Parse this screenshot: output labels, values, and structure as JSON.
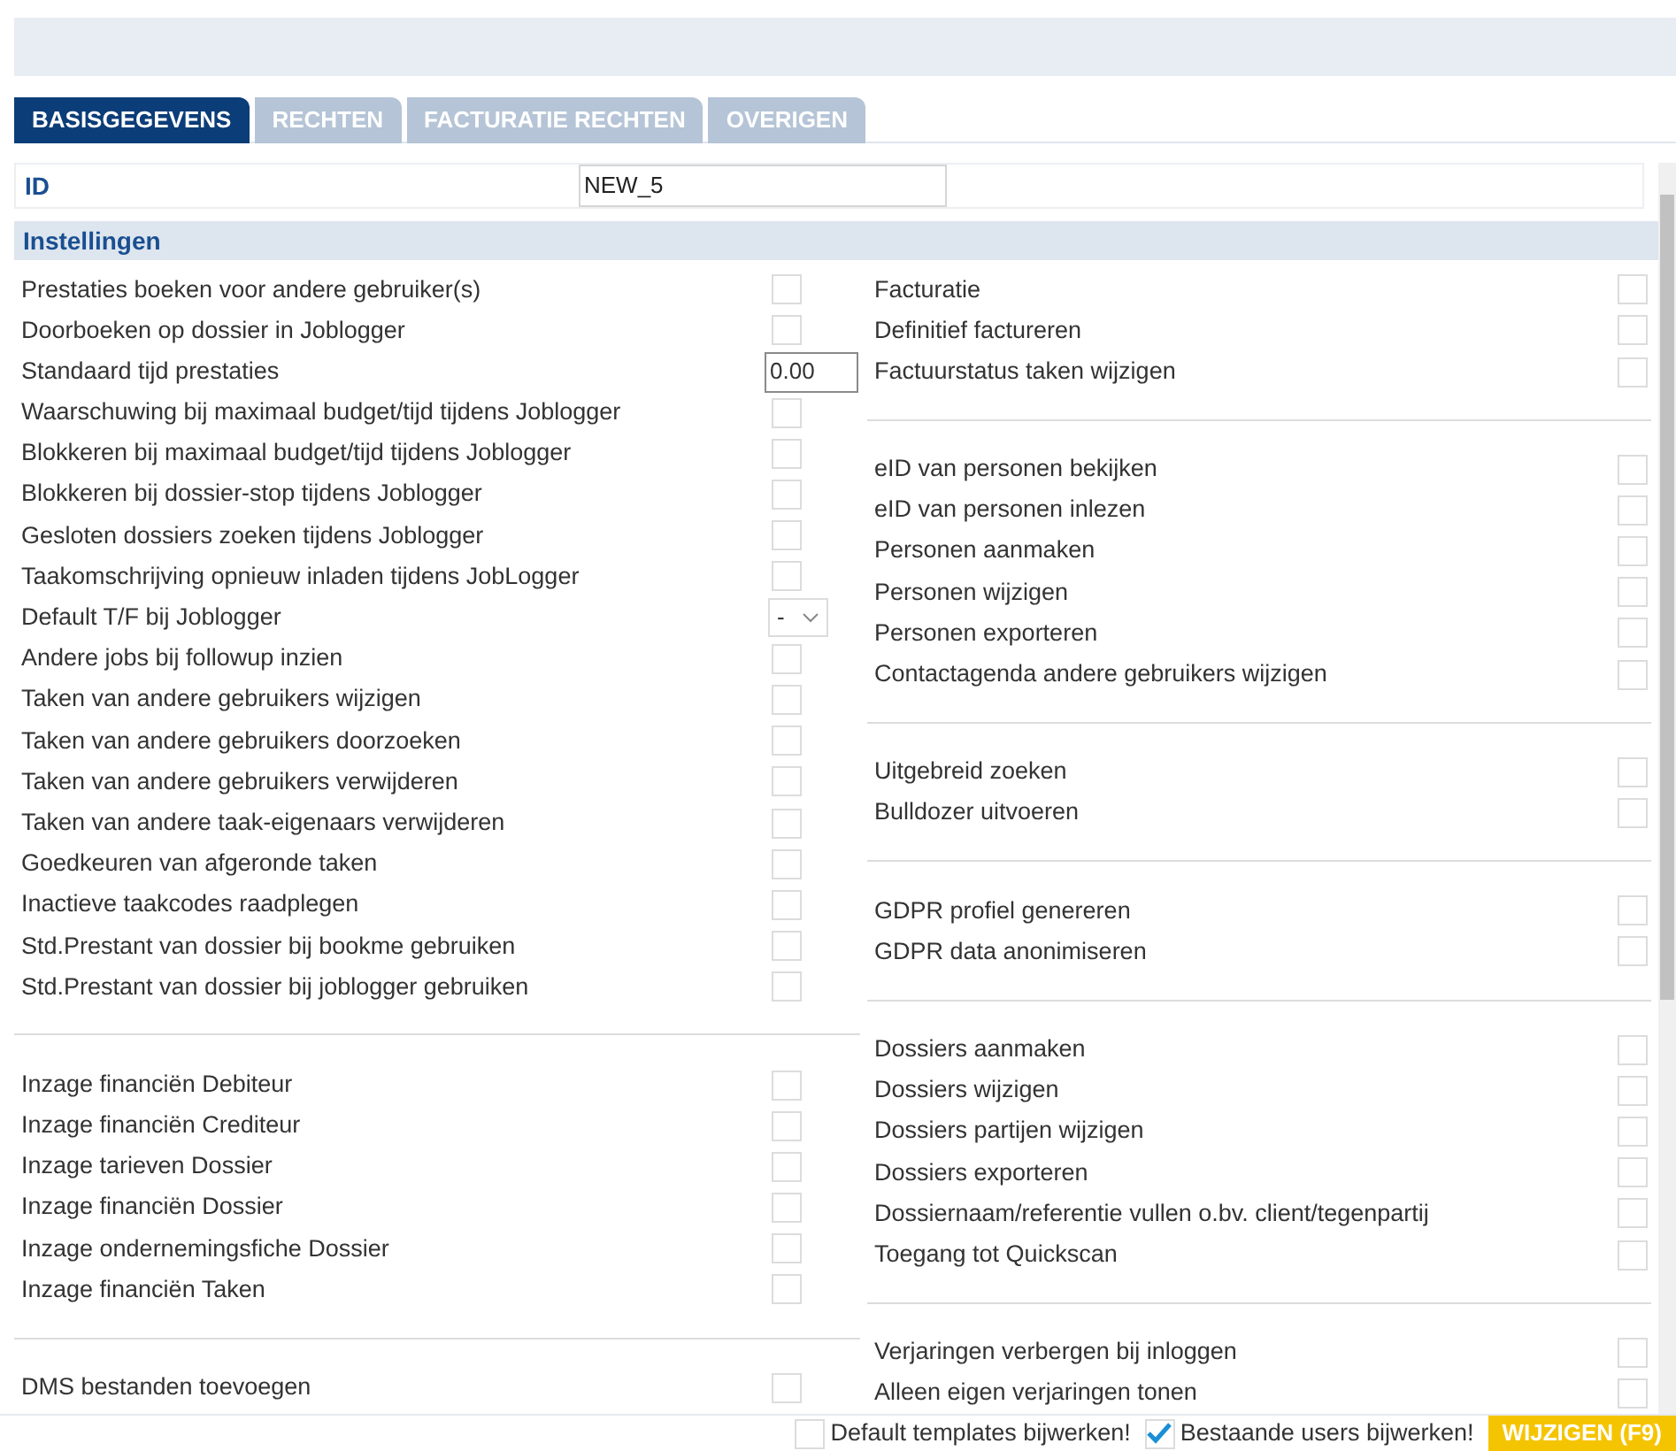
{
  "tabs": [
    {
      "label": "BASISGEGEVENS",
      "selected": true
    },
    {
      "label": "RECHTEN",
      "selected": false
    },
    {
      "label": "FACTURATIE RECHTEN",
      "selected": false
    },
    {
      "label": "OVERIGEN",
      "selected": false
    }
  ],
  "id_field": {
    "label": "ID",
    "value": "NEW_5"
  },
  "section": {
    "title": "Instellingen"
  },
  "left_groups": [
    {
      "items": [
        {
          "kind": "checkbox",
          "label": "Prestaties boeken voor andere gebruiker(s)",
          "checked": false
        },
        {
          "kind": "checkbox",
          "label": "Doorboeken op dossier in Joblogger",
          "checked": false
        },
        {
          "kind": "number",
          "label": "Standaard tijd prestaties",
          "value": "0.00"
        },
        {
          "kind": "checkbox",
          "label": "Waarschuwing bij maximaal budget/tijd tijdens Joblogger",
          "checked": false
        },
        {
          "kind": "checkbox",
          "label": "Blokkeren bij maximaal budget/tijd tijdens Joblogger",
          "checked": false
        },
        {
          "kind": "checkbox",
          "label": "Blokkeren bij dossier-stop tijdens Joblogger",
          "checked": false
        },
        {
          "kind": "checkbox",
          "label": "Gesloten dossiers zoeken tijdens Joblogger",
          "checked": false
        },
        {
          "kind": "checkbox",
          "label": "Taakomschrijving opnieuw inladen tijdens JobLogger",
          "checked": false
        },
        {
          "kind": "select",
          "label": "Default T/F bij Joblogger",
          "value": "-"
        },
        {
          "kind": "checkbox",
          "label": "Andere jobs bij followup inzien",
          "checked": false
        },
        {
          "kind": "checkbox",
          "label": "Taken van andere gebruikers wijzigen",
          "checked": false
        },
        {
          "kind": "checkbox",
          "label": "Taken van andere gebruikers doorzoeken",
          "checked": false
        },
        {
          "kind": "checkbox",
          "label": "Taken van andere gebruikers verwijderen",
          "checked": false
        },
        {
          "kind": "checkbox",
          "label": "Taken van andere taak-eigenaars verwijderen",
          "checked": false
        },
        {
          "kind": "checkbox",
          "label": "Goedkeuren van afgeronde taken",
          "checked": false
        },
        {
          "kind": "checkbox",
          "label": "Inactieve taakcodes raadplegen",
          "checked": false
        },
        {
          "kind": "checkbox",
          "label": "Std.Prestant van dossier bij bookme gebruiken",
          "checked": false
        },
        {
          "kind": "checkbox",
          "label": "Std.Prestant van dossier bij joblogger gebruiken",
          "checked": false
        }
      ]
    },
    {
      "items": [
        {
          "kind": "checkbox",
          "label": "Inzage financiën Debiteur",
          "checked": false
        },
        {
          "kind": "checkbox",
          "label": "Inzage financiën Crediteur",
          "checked": false
        },
        {
          "kind": "checkbox",
          "label": "Inzage tarieven Dossier",
          "checked": false
        },
        {
          "kind": "checkbox",
          "label": "Inzage financiën Dossier",
          "checked": false
        },
        {
          "kind": "checkbox",
          "label": "Inzage ondernemingsfiche Dossier",
          "checked": false
        },
        {
          "kind": "checkbox",
          "label": "Inzage financiën Taken",
          "checked": false
        }
      ]
    },
    {
      "items": [
        {
          "kind": "checkbox",
          "label": "DMS bestanden toevoegen",
          "checked": false
        }
      ]
    }
  ],
  "right_groups": [
    {
      "items": [
        {
          "kind": "checkbox",
          "label": "Facturatie",
          "checked": false
        },
        {
          "kind": "checkbox",
          "label": "Definitief factureren",
          "checked": false
        },
        {
          "kind": "checkbox",
          "label": "Factuurstatus taken wijzigen",
          "checked": false
        }
      ]
    },
    {
      "items": [
        {
          "kind": "checkbox",
          "label": "eID van personen bekijken",
          "checked": false
        },
        {
          "kind": "checkbox",
          "label": "eID van personen inlezen",
          "checked": false
        },
        {
          "kind": "checkbox",
          "label": "Personen aanmaken",
          "checked": false
        },
        {
          "kind": "checkbox",
          "label": "Personen wijzigen",
          "checked": false
        },
        {
          "kind": "checkbox",
          "label": "Personen exporteren",
          "checked": false
        },
        {
          "kind": "checkbox",
          "label": "Contactagenda andere gebruikers wijzigen",
          "checked": false
        }
      ]
    },
    {
      "items": [
        {
          "kind": "checkbox",
          "label": "Uitgebreid zoeken",
          "checked": false
        },
        {
          "kind": "checkbox",
          "label": "Bulldozer uitvoeren",
          "checked": false
        }
      ]
    },
    {
      "items": [
        {
          "kind": "checkbox",
          "label": "GDPR profiel genereren",
          "checked": false
        },
        {
          "kind": "checkbox",
          "label": "GDPR data anonimiseren",
          "checked": false
        }
      ]
    },
    {
      "items": [
        {
          "kind": "checkbox",
          "label": "Dossiers aanmaken",
          "checked": false
        },
        {
          "kind": "checkbox",
          "label": "Dossiers wijzigen",
          "checked": false
        },
        {
          "kind": "checkbox",
          "label": "Dossiers partijen wijzigen",
          "checked": false
        },
        {
          "kind": "checkbox",
          "label": "Dossiers exporteren",
          "checked": false
        },
        {
          "kind": "checkbox",
          "label": "Dossiernaam/referentie vullen o.bv. client/tegenpartij",
          "checked": false
        },
        {
          "kind": "checkbox",
          "label": "Toegang tot Quickscan",
          "checked": false
        }
      ]
    },
    {
      "items": [
        {
          "kind": "checkbox",
          "label": "Verjaringen verbergen bij inloggen",
          "checked": false
        },
        {
          "kind": "checkbox",
          "label": "Alleen eigen verjaringen tonen",
          "checked": false
        }
      ]
    }
  ],
  "footer": {
    "options": [
      {
        "label": "Default templates bijwerken!",
        "checked": false
      },
      {
        "label": "Bestaande users bijwerken!",
        "checked": true
      }
    ],
    "button": "WIJZIGEN (F9)"
  }
}
